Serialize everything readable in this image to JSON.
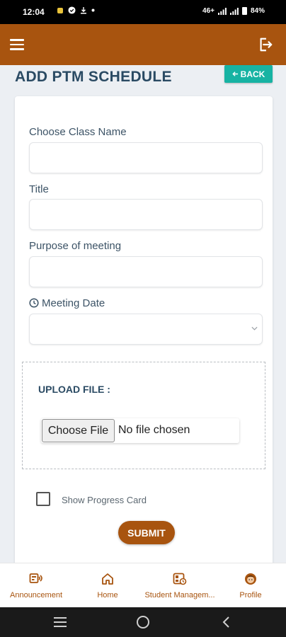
{
  "status_bar": {
    "time": "12:04",
    "network": "46+",
    "battery": "84%"
  },
  "app_bar": {
    "menu_icon": "hamburger-menu-icon",
    "logout_icon": "logout-icon"
  },
  "page": {
    "title": "ADD PTM SCHEDULE",
    "back_label": "BACK"
  },
  "form": {
    "class_name_label": "Choose Class Name",
    "class_name_value": "",
    "title_label": "Title",
    "title_value": "",
    "purpose_label": "Purpose of meeting",
    "purpose_value": "",
    "date_label": "Meeting Date",
    "date_value": "",
    "upload_label": "UPLOAD FILE :",
    "choose_file_label": "Choose File",
    "no_file_label": "No file chosen",
    "progress_card_label": "Show Progress Card",
    "progress_card_checked": false,
    "submit_label": "SUBMIT"
  },
  "bottom_nav": {
    "items": [
      {
        "label": "Announcement",
        "icon": "announcement-icon"
      },
      {
        "label": "Home",
        "icon": "home-icon"
      },
      {
        "label": "Student Managem...",
        "icon": "student-management-icon"
      },
      {
        "label": "Profile",
        "icon": "profile-icon"
      }
    ]
  },
  "colors": {
    "brand": "#a8540f",
    "accent": "#17b3a3",
    "heading": "#2a4a63"
  }
}
